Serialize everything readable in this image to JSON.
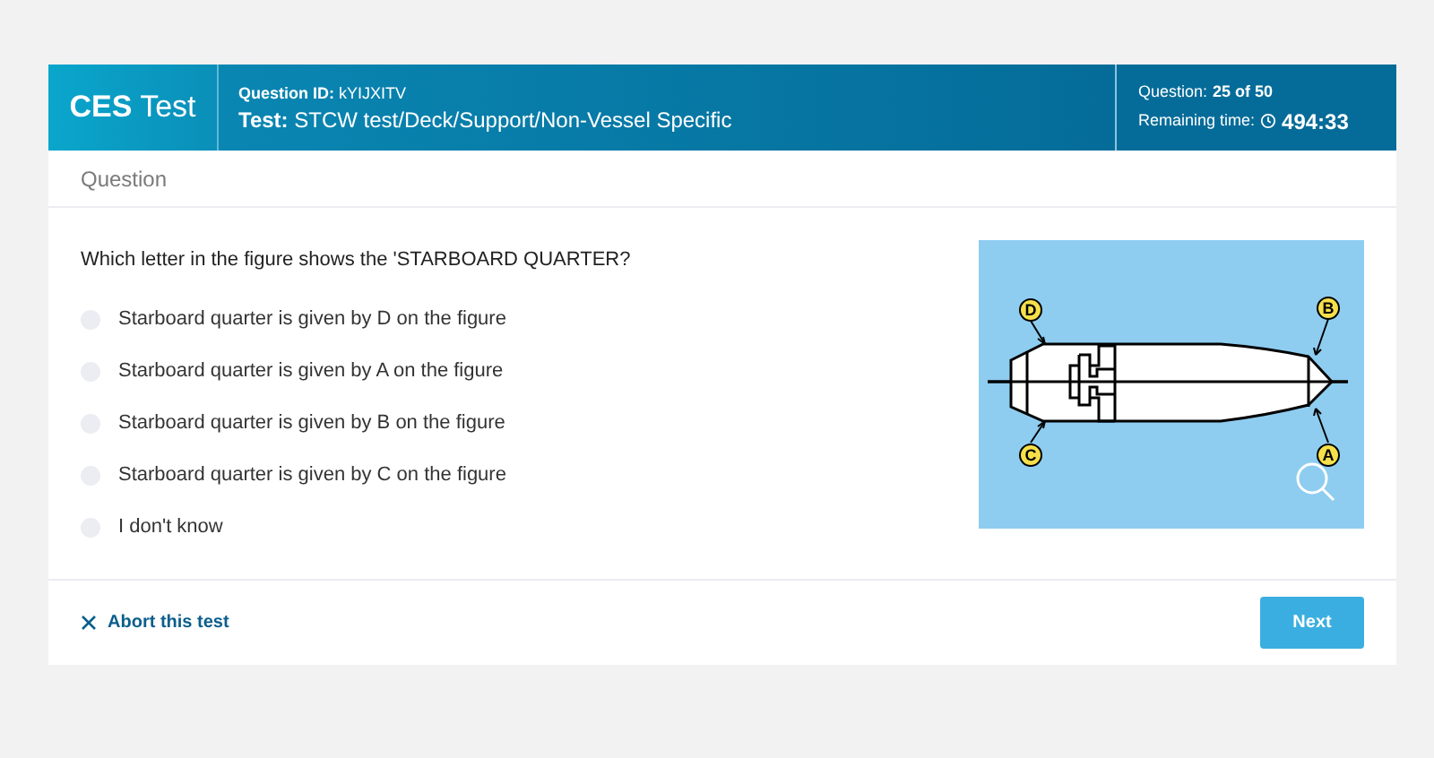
{
  "brand": {
    "strong": "CES",
    "light": "Test"
  },
  "header": {
    "question_id": "**Question ID:** kYIJXITV",
    "test": "**Test:** STCW test/Deck/Support/Non-Vessel Specific",
    "progress_label": "Question:",
    "progress_value": "25 of 50",
    "time_label": "Remaining time:",
    "time_value": "494:33"
  },
  "section_title": "Question",
  "question": "Which letter in the figure shows the 'STARBOARD QUARTER?",
  "options": [
    {
      "label": "Starboard quarter is given by D on the figure",
      "selected": false
    },
    {
      "label": "Starboard quarter is given by A on the figure",
      "selected": false
    },
    {
      "label": "Starboard quarter is given by B on the figure",
      "selected": false
    },
    {
      "label": "Starboard quarter is given by C on the figure",
      "selected": false
    },
    {
      "label": "I don't know",
      "selected": false
    }
  ],
  "figure": {
    "labels": [
      "D",
      "B",
      "C",
      "A"
    ]
  },
  "footer": {
    "abort": "Abort this test",
    "next": "Next"
  }
}
